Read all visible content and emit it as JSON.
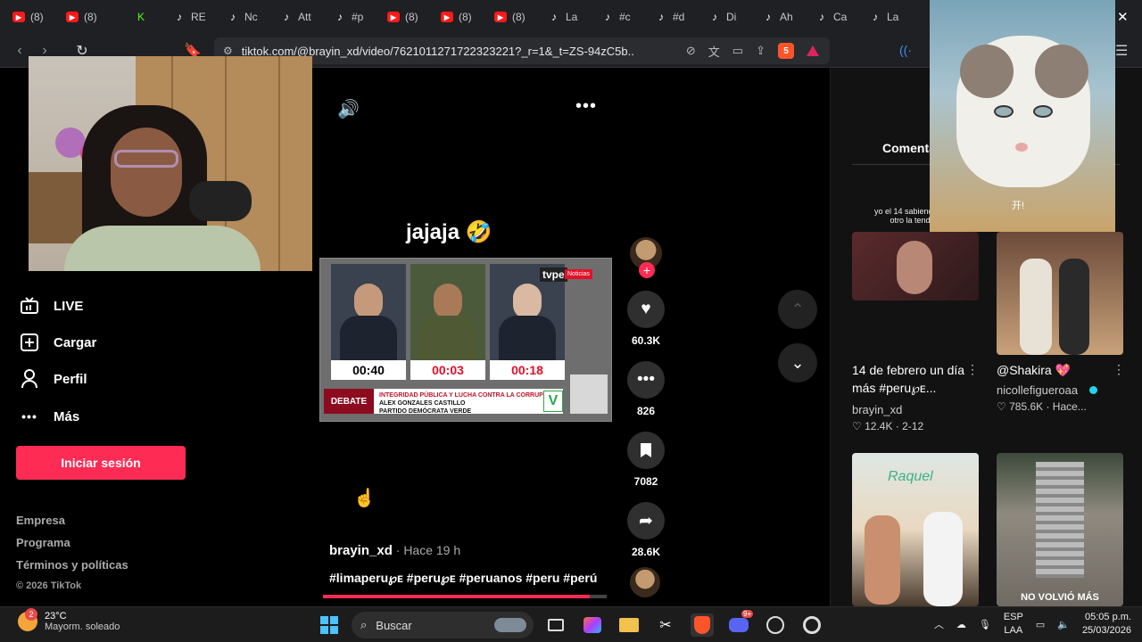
{
  "browser": {
    "tabs": [
      {
        "fav": "yt",
        "label": "(8)"
      },
      {
        "fav": "yt",
        "label": "(8)"
      },
      {
        "fav": "kk",
        "label": "K"
      },
      {
        "fav": "tt",
        "label": "RE"
      },
      {
        "fav": "tt",
        "label": "Nc"
      },
      {
        "fav": "tt",
        "label": "Att"
      },
      {
        "fav": "tt",
        "label": "#p"
      },
      {
        "fav": "yt",
        "label": "(8)"
      },
      {
        "fav": "yt",
        "label": "(8)"
      },
      {
        "fav": "yt",
        "label": "(8)"
      },
      {
        "fav": "tt",
        "label": "La"
      },
      {
        "fav": "tt",
        "label": "#c"
      },
      {
        "fav": "tt",
        "label": "#d"
      },
      {
        "fav": "tt",
        "label": "Di"
      },
      {
        "fav": "tt",
        "label": "Ah"
      },
      {
        "fav": "tt",
        "label": "Ca"
      },
      {
        "fav": "tt",
        "label": "La"
      }
    ],
    "url": "tiktok.com/@brayin_xd/video/7621011271722323221?_r=1&_t=ZS-94zC5b...",
    "brave_badge": "5",
    "close_glyph": "✕"
  },
  "sidebar": {
    "items": [
      {
        "label": "LIVE",
        "icon": "live-icon"
      },
      {
        "label": "Cargar",
        "icon": "upload-icon"
      },
      {
        "label": "Perfil",
        "icon": "profile-icon"
      },
      {
        "label": "Más",
        "icon": "more-icon"
      }
    ],
    "login_label": "Iniciar sesión",
    "footer": [
      "Empresa",
      "Programa",
      "Términos y políticas"
    ],
    "copyright": "© 2026 TikTok"
  },
  "video": {
    "caption": "jajaja 🤣",
    "debate": {
      "timers": [
        "00:40",
        "00:03",
        "00:18"
      ],
      "tvpe": "tvpe",
      "noticias": "Noticias",
      "debate_label": "DEBATE",
      "candidate_line1": "INTEGRIDAD PÚBLICA Y LUCHA CONTRA LA CORRUPCIÓN",
      "candidate_line2": "ALEX GONZALES CASTILLO",
      "candidate_line3": "PARTIDO DEMÓCRATA VERDE",
      "v_logo": "V"
    },
    "likes": "60.3K",
    "comments": "826",
    "saves": "7082",
    "shares": "28.6K",
    "author": "brayin_xd",
    "time": " · Hace 19 h",
    "hashtags": "#limaperu℘ᴇ #peru℘ᴇ #peruanos #peru #perú",
    "progress": 0.94
  },
  "right": {
    "comments_tab": "Comenta",
    "cards": [
      {
        "title": "14 de febrero un día más #peru℘ᴇ...",
        "user": "brayin_xd",
        "meta": "♡ 12.4K · 2-12",
        "thumb_text": "yo el 14 sabiendo que otro la tendrá"
      },
      {
        "title": "@Shakira 💖",
        "user": "nicollefigueroaa",
        "meta": "♡ 785.6K · Hace...",
        "thumb_text": ""
      },
      {
        "title": "",
        "user": "",
        "meta": "",
        "thumb_text": "Raquel"
      },
      {
        "title": "",
        "user": "",
        "meta": "",
        "thumb_text": "NO VOLVIÓ MÁS"
      }
    ],
    "cat_tag": "开!"
  },
  "taskbar": {
    "temp": "23°C",
    "weather": "Mayorm. soleado",
    "weather_badge": "2",
    "search_placeholder": "Buscar",
    "lang1": "ESP",
    "lang2": "LAA",
    "time": "05:05 p.m.",
    "date": "25/03/2026",
    "discord_badge": "9+"
  }
}
